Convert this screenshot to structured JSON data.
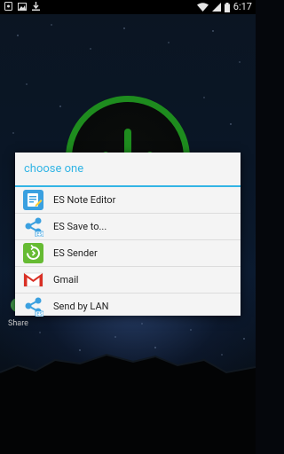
{
  "status_bar": {
    "time": "6:17",
    "icons": [
      "notification-icon",
      "image-icon",
      "download-icon",
      "wifi-icon",
      "signal-icon",
      "battery-icon"
    ]
  },
  "background": {
    "share_label": "Share"
  },
  "dialog": {
    "title": "choose one",
    "accent_color": "#33b5e5",
    "items": [
      {
        "label": "ES Note Editor",
        "icon": "es-note-editor-icon"
      },
      {
        "label": "ES Save to...",
        "icon": "es-save-to-icon"
      },
      {
        "label": "ES Sender",
        "icon": "es-sender-icon"
      },
      {
        "label": "Gmail",
        "icon": "gmail-icon"
      },
      {
        "label": "Send by LAN",
        "icon": "send-by-lan-icon"
      }
    ]
  }
}
